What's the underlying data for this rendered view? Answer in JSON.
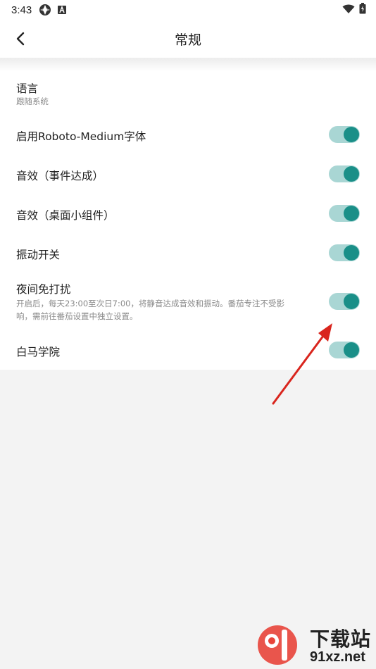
{
  "status_bar": {
    "time": "3:43"
  },
  "header": {
    "title": "常规"
  },
  "settings": {
    "language": {
      "label": "语言",
      "value": "跟随系统"
    },
    "items": [
      {
        "label": "启用Roboto-Medium字体",
        "on": true
      },
      {
        "label": "音效（事件达成）",
        "on": true
      },
      {
        "label": "音效（桌面小组件）",
        "on": true
      },
      {
        "label": "振动开关",
        "on": true
      },
      {
        "label": "夜间免打扰",
        "description_line1": "开启后，每天23:00至次日7:00，将静音达成音效和振动。番茄专注不受影",
        "description_line2": "响，需前往番茄设置中独立设置。",
        "on": true
      },
      {
        "label": "白马学院",
        "on": true
      }
    ]
  },
  "watermark": {
    "line1": "下载站",
    "line2": "91xz.net"
  },
  "colors": {
    "toggle_track": "#a9d6d4",
    "toggle_knob": "#1a8f88",
    "annotation_arrow": "#d9251d",
    "background": "#f3f3f3"
  }
}
